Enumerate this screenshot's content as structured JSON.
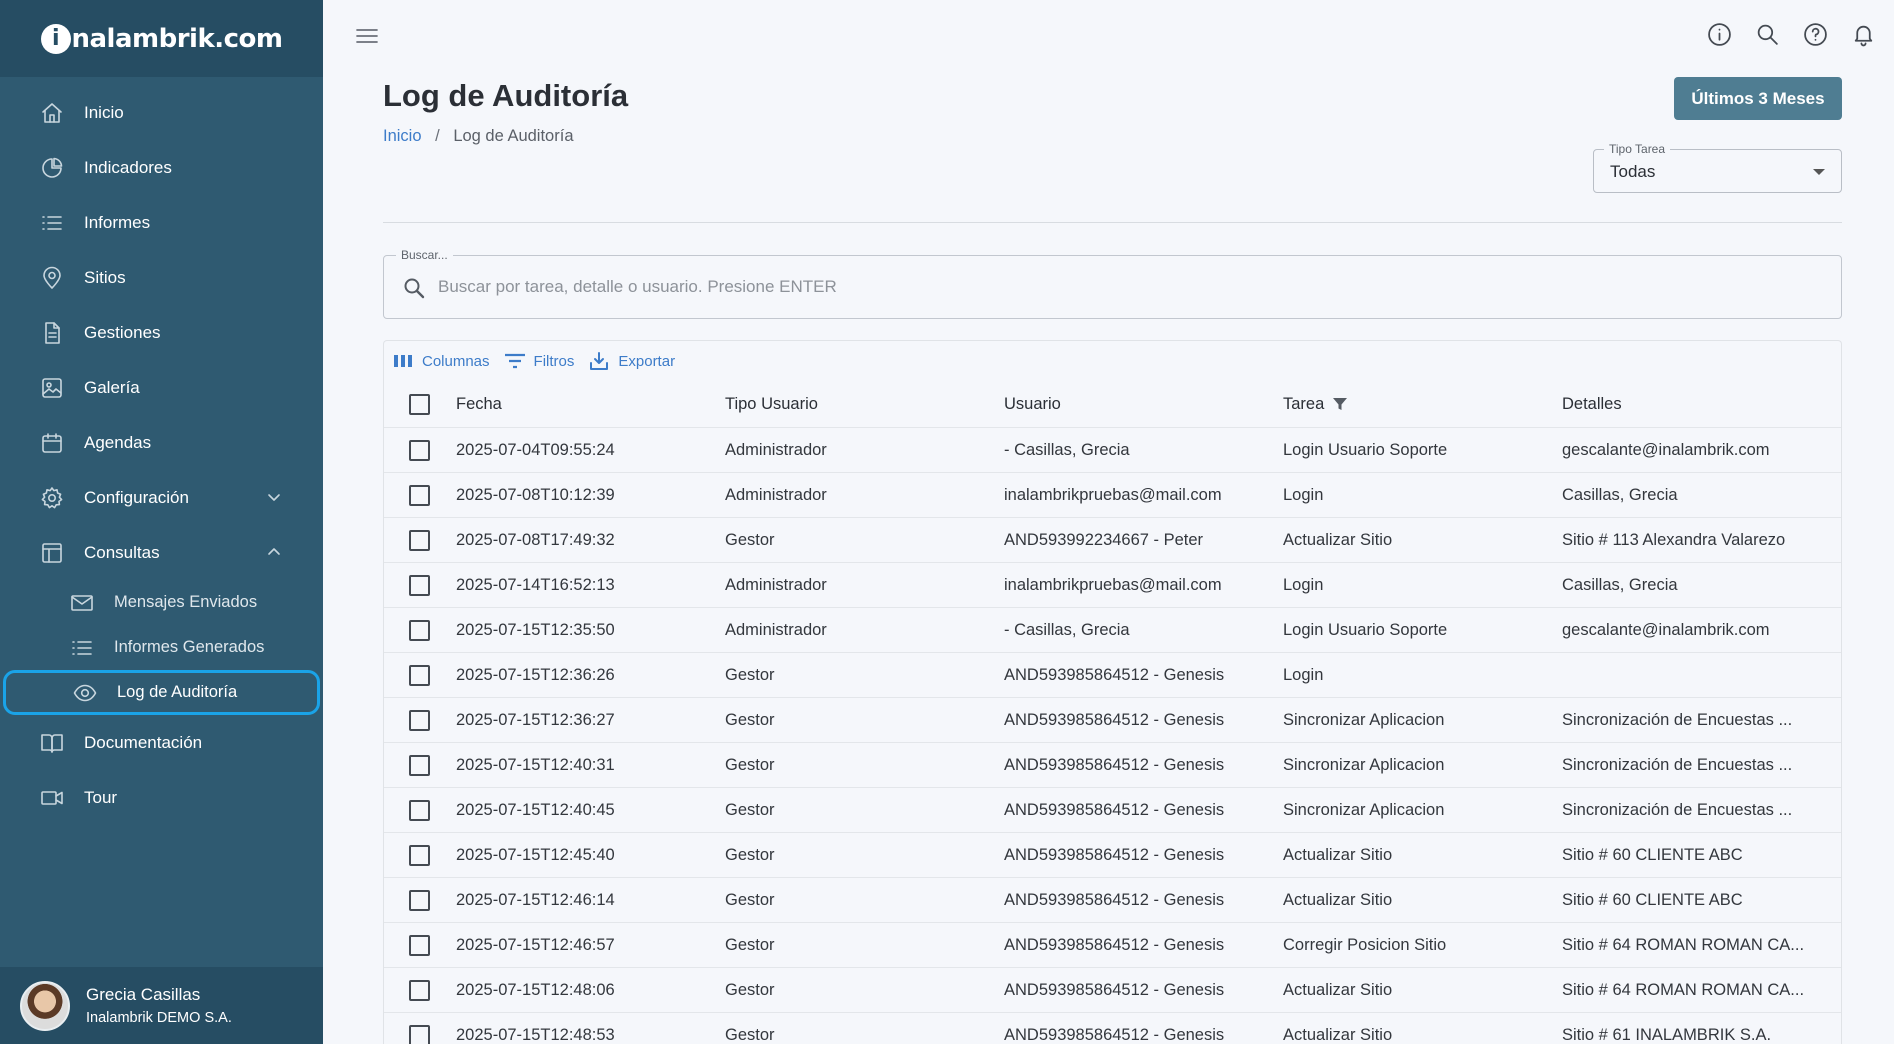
{
  "brand": {
    "logo_initial": "i",
    "logo_text": "nalambrik.com"
  },
  "sidebar": {
    "items": [
      {
        "label": "Inicio",
        "icon": "home-icon"
      },
      {
        "label": "Indicadores",
        "icon": "pie-chart-icon"
      },
      {
        "label": "Informes",
        "icon": "list-icon"
      },
      {
        "label": "Sitios",
        "icon": "location-pin-icon"
      },
      {
        "label": "Gestiones",
        "icon": "document-icon"
      },
      {
        "label": "Galería",
        "icon": "image-icon"
      },
      {
        "label": "Agendas",
        "icon": "calendar-icon"
      },
      {
        "label": "Configuración",
        "icon": "gear-icon",
        "expandable": true,
        "expanded": false
      },
      {
        "label": "Consultas",
        "icon": "table-icon",
        "expandable": true,
        "expanded": true
      },
      {
        "label": "Documentación",
        "icon": "book-icon"
      },
      {
        "label": "Tour",
        "icon": "video-icon"
      }
    ],
    "consultas_sub": [
      {
        "label": "Mensajes Enviados",
        "icon": "envelope-icon"
      },
      {
        "label": "Informes Generados",
        "icon": "list-icon"
      },
      {
        "label": "Log de Auditoría",
        "icon": "eye-icon",
        "active": true
      }
    ],
    "user": {
      "name": "Grecia Casillas",
      "company": "Inalambrik DEMO S.A."
    }
  },
  "header": {
    "title": "Log de Auditoría",
    "breadcrumb": {
      "home": "Inicio",
      "separator": "/",
      "current": "Log de Auditoría"
    },
    "range_button": "Últimos 3 Meses",
    "task_type": {
      "label": "Tipo Tarea",
      "value": "Todas"
    }
  },
  "search": {
    "label": "Buscar...",
    "placeholder": "Buscar por tarea, detalle o usuario. Presione ENTER"
  },
  "grid": {
    "toolbar": {
      "columns": "Columnas",
      "filters": "Filtros",
      "export": "Exportar"
    },
    "columns": [
      "Fecha",
      "Tipo Usuario",
      "Usuario",
      "Tarea",
      "Detalles"
    ],
    "rows": [
      [
        "2025-07-04T09:55:24",
        "Administrador",
        "- Casillas, Grecia",
        "Login Usuario Soporte",
        "gescalante@inalambrik.com"
      ],
      [
        "2025-07-08T10:12:39",
        "Administrador",
        "inalambrikpruebas@mail.com",
        "Login",
        "Casillas, Grecia"
      ],
      [
        "2025-07-08T17:49:32",
        "Gestor",
        "AND593992234667 - Peter",
        "Actualizar Sitio",
        "Sitio # 113 Alexandra Valarezo"
      ],
      [
        "2025-07-14T16:52:13",
        "Administrador",
        "inalambrikpruebas@mail.com",
        "Login",
        "Casillas, Grecia"
      ],
      [
        "2025-07-15T12:35:50",
        "Administrador",
        "- Casillas, Grecia",
        "Login Usuario Soporte",
        "gescalante@inalambrik.com"
      ],
      [
        "2025-07-15T12:36:26",
        "Gestor",
        "AND593985864512 - Genesis",
        "Login",
        ""
      ],
      [
        "2025-07-15T12:36:27",
        "Gestor",
        "AND593985864512 - Genesis",
        "Sincronizar Aplicacion",
        "Sincronización de Encuestas ..."
      ],
      [
        "2025-07-15T12:40:31",
        "Gestor",
        "AND593985864512 - Genesis",
        "Sincronizar Aplicacion",
        "Sincronización de Encuestas ..."
      ],
      [
        "2025-07-15T12:40:45",
        "Gestor",
        "AND593985864512 - Genesis",
        "Sincronizar Aplicacion",
        "Sincronización de Encuestas ..."
      ],
      [
        "2025-07-15T12:45:40",
        "Gestor",
        "AND593985864512 - Genesis",
        "Actualizar Sitio",
        "Sitio # 60 CLIENTE ABC"
      ],
      [
        "2025-07-15T12:46:14",
        "Gestor",
        "AND593985864512 - Genesis",
        "Actualizar Sitio",
        "Sitio # 60 CLIENTE ABC"
      ],
      [
        "2025-07-15T12:46:57",
        "Gestor",
        "AND593985864512 - Genesis",
        "Corregir Posicion Sitio",
        "Sitio # 64 ROMAN ROMAN CA..."
      ],
      [
        "2025-07-15T12:48:06",
        "Gestor",
        "AND593985864512 - Genesis",
        "Actualizar Sitio",
        "Sitio # 64 ROMAN ROMAN CA..."
      ],
      [
        "2025-07-15T12:48:53",
        "Gestor",
        "AND593985864512 - Genesis",
        "Actualizar Sitio",
        "Sitio # 61 INALAMBRIK S.A."
      ]
    ]
  },
  "colors": {
    "sidebar_bg": "#2f5a71",
    "sidebar_header_bg": "#264d63",
    "active_outline": "#1aa3e8",
    "primary_button": "#4f7d92",
    "link": "#3d7cc9",
    "page_bg": "#f5f7fb"
  }
}
